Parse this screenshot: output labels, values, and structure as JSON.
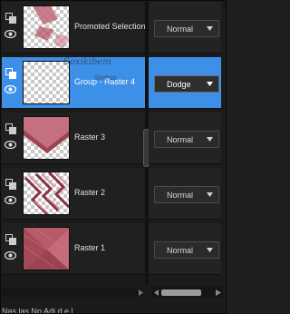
{
  "layers": [
    {
      "name": "Promoted Selection",
      "blend": "Normal",
      "selected": false
    },
    {
      "name": "Group - Raster 4",
      "blend": "Dodge",
      "selected": true
    },
    {
      "name": "Raster 3",
      "blend": "Normal",
      "selected": false
    },
    {
      "name": "Raster 2",
      "blend": "Normal",
      "selected": false
    },
    {
      "name": "Raster 1",
      "blend": "Normal",
      "selected": false
    }
  ],
  "watermark": {
    "text": "Soxikibem",
    "sub": "SimPsp"
  },
  "bottom_text": "Nas     las    No    Adi  d    e   l",
  "colors": {
    "selected": "#3d90e8",
    "layer_pink": "#b0505e"
  },
  "icons": {
    "mask": "layer-type-icon",
    "visibility": "eye-icon"
  }
}
